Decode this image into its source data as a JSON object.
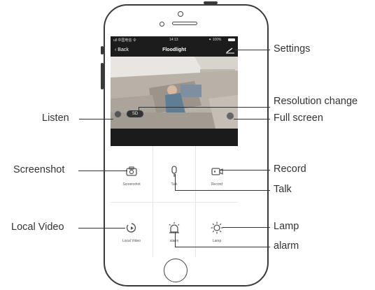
{
  "app": {
    "title": "Floodlight",
    "back_label": "Back",
    "status_carrier": "ull 中国电信 令",
    "status_time": "14:13",
    "status_battery": "⁕ 100%"
  },
  "video": {
    "resolution_label": "SD"
  },
  "controls": [
    {
      "label": "Screenshot",
      "icon": "camera-icon"
    },
    {
      "label": "Talk",
      "icon": "microphone-icon"
    },
    {
      "label": "Record",
      "icon": "video-record-icon"
    },
    {
      "label": "Local Video",
      "icon": "local-video-icon"
    },
    {
      "label": "alarm",
      "icon": "alarm-icon"
    },
    {
      "label": "Lamp",
      "icon": "lamp-icon"
    }
  ],
  "callouts": {
    "settings": "Settings",
    "resolution": "Resolution change",
    "listen": "Listen",
    "fullscreen": "Full screen",
    "screenshot": "Screenshot",
    "record": "Record",
    "talk": "Talk",
    "local_video": "Local Video",
    "lamp": "Lamp",
    "alarm": "alarm"
  },
  "colors": {
    "frame": "#3a3a3a",
    "topbar": "#1c1c1c",
    "text": "#333333"
  }
}
